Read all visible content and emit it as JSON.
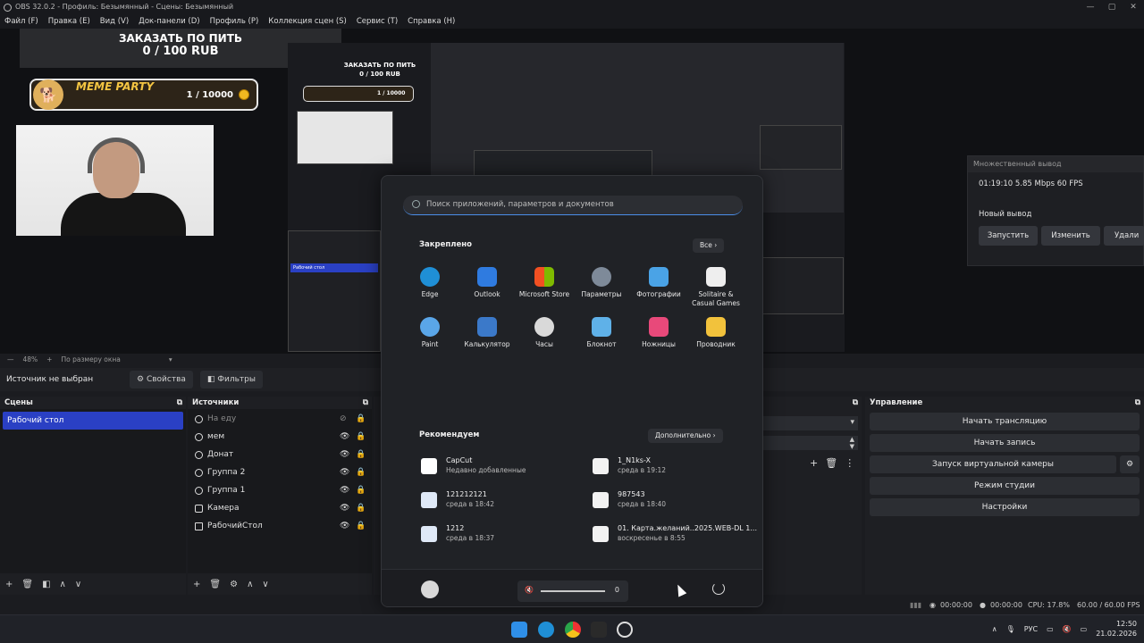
{
  "window": {
    "title": "OBS 32.0.2 - Профиль: Безымянный - Сцены: Безымянный",
    "controls": [
      "—",
      "▢",
      "✕"
    ]
  },
  "menubar": [
    "Файл (F)",
    "Правка (E)",
    "Вид (V)",
    "Док-панели (D)",
    "Профиль (P)",
    "Коллекция сцен (S)",
    "Сервис (T)",
    "Справка (H)"
  ],
  "preview": {
    "donate_line1": "ЗАКАЗАТЬ ПО ПИТЬ",
    "donate_line2": "0 / 100 RUB",
    "meme_title": "MEME PARTY",
    "meme_count": "1 / 10000",
    "nested_donate_line1": "ЗАКАЗАТЬ ПО ПИТЬ",
    "nested_donate_line2": "0 / 100 RUB",
    "nested_meme_count": "1 / 10000",
    "nested_scene": "Рабочий стол",
    "multi_output": {
      "title": "Множественный вывод",
      "stats": "01:19:10  5.85 Mbps  60 FPS",
      "new_output": "Новый вывод",
      "start": "Запустить",
      "edit": "Изменить",
      "delete": "Удали"
    }
  },
  "zoom": {
    "percent": "48%",
    "plus": "+",
    "mode": "По размеру окна"
  },
  "source_toolbar": {
    "none_selected": "Источник не выбран",
    "properties": "Свойства",
    "filters": "Фильтры"
  },
  "scenes": {
    "title": "Сцены",
    "items": [
      "Рабочий стол"
    ]
  },
  "sources": {
    "title": "Источники",
    "items": [
      "На еду",
      "мем",
      "Донат",
      "Группа 2",
      "Группа 1",
      "Камера",
      "РабочийСтол"
    ]
  },
  "controls": {
    "title": "Управление",
    "start_stream": "Начать трансляцию",
    "start_record": "Начать запись",
    "virtual_cam": "Запуск виртуальной камеры",
    "studio_mode": "Режим студии",
    "settings": "Настройки"
  },
  "status": {
    "stream_time": "00:00:00",
    "rec_time": "00:00:00",
    "cpu": "CPU: 17.8%",
    "fps": "60.00 / 60.00 FPS"
  },
  "start_menu": {
    "search_placeholder": "Поиск приложений, параметров и документов",
    "pinned_title": "Закреплено",
    "all_button": "Все",
    "apps": [
      {
        "label": "Edge",
        "icon": "edge-icon",
        "color": "#1f8fd6"
      },
      {
        "label": "Outlook",
        "icon": "outlook-icon",
        "color": "#2f7be0"
      },
      {
        "label": "Microsoft Store",
        "icon": "store-icon",
        "color": "#f0f0f0"
      },
      {
        "label": "Параметры",
        "icon": "settings-gear-icon",
        "color": "#7e8a99"
      },
      {
        "label": "Фотографии",
        "icon": "photos-icon",
        "color": "#4aa3e6"
      },
      {
        "label": "Solitaire & Casual Games",
        "icon": "solitaire-icon",
        "color": "#eeeeee"
      },
      {
        "label": "Paint",
        "icon": "paint-icon",
        "color": "#5aa6e8"
      },
      {
        "label": "Калькулятор",
        "icon": "calculator-icon",
        "color": "#3b79c9"
      },
      {
        "label": "Часы",
        "icon": "clock-icon",
        "color": "#d9d9d9"
      },
      {
        "label": "Блокнот",
        "icon": "notepad-icon",
        "color": "#5fb1e8"
      },
      {
        "label": "Ножницы",
        "icon": "snipping-tool-icon",
        "color": "#e8497a"
      },
      {
        "label": "Проводник",
        "icon": "file-explorer-icon",
        "color": "#f2c23c"
      }
    ],
    "recommended_title": "Рекомендуем",
    "more_button": "Дополнительно",
    "recommended": [
      {
        "name": "CapCut",
        "sub": "Недавно добавленные",
        "icon": "capcut-icon"
      },
      {
        "name": "1_N1ks-X",
        "sub": "среда в 19:12",
        "icon": "video-file-icon"
      },
      {
        "name": "121212121",
        "sub": "среда в 18:42",
        "icon": "image-file-icon"
      },
      {
        "name": "987543",
        "sub": "среда в 18:40",
        "icon": "video-file-icon"
      },
      {
        "name": "1212",
        "sub": "среда в 18:37",
        "icon": "image-file-icon"
      },
      {
        "name": "01. Карта.желаний..2025.WEB-DL 1...",
        "sub": "воскресенье в 8:55",
        "icon": "video-file-icon"
      }
    ],
    "volume": "0"
  },
  "taskbar": {
    "lang": "РУС",
    "time": "12:50",
    "date": "21.02.2026"
  }
}
